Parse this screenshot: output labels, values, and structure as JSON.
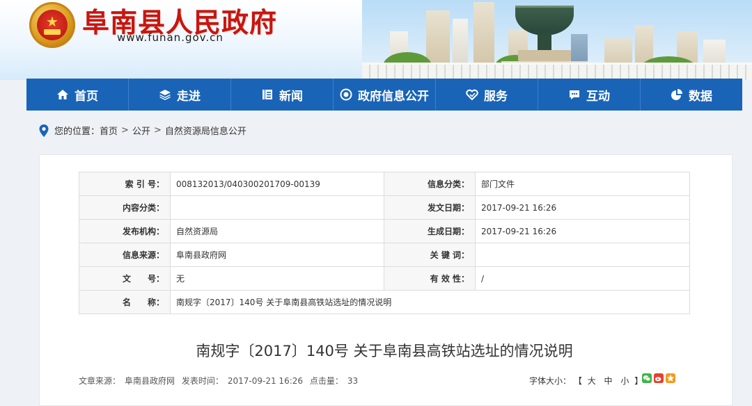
{
  "header": {
    "site_title": "阜南县人民政府",
    "site_url": "www.funan.gov.cn"
  },
  "nav": {
    "items": [
      {
        "label": "首页",
        "icon": "home-icon"
      },
      {
        "label": "走进",
        "icon": "layers-icon"
      },
      {
        "label": "新闻",
        "icon": "news-icon"
      },
      {
        "label": "政府信息公开",
        "icon": "eye-icon"
      },
      {
        "label": "服务",
        "icon": "service-icon"
      },
      {
        "label": "互动",
        "icon": "chat-icon"
      },
      {
        "label": "数据",
        "icon": "pie-chart-icon"
      }
    ]
  },
  "breadcrumb": {
    "prefix": "您的位置：",
    "items": [
      "首页",
      "公开",
      "自然资源局信息公开"
    ],
    "separator": ">"
  },
  "meta": {
    "index_label": "索 引 号：",
    "index_value": "008132013/040300201709-00139",
    "category_label": "信息分类：",
    "category_value": "部门文件",
    "content_class_label": "内容分类：",
    "content_class_value": "",
    "issue_date_label": "发文日期：",
    "issue_date_value": "2017-09-21 16:26",
    "publisher_label": "发布机构：",
    "publisher_value": "自然资源局",
    "generate_date_label": "生成日期：",
    "generate_date_value": "2017-09-21 16:26",
    "source_label": "信息来源：",
    "source_value": "阜南县政府网",
    "keywords_label": "关 键 词：",
    "keywords_value": "",
    "doc_no_label": "文　　号：",
    "doc_no_value": "无",
    "validity_label": "有 效 性：",
    "validity_value": "/",
    "name_label": "名　　称：",
    "name_value": "南规字〔2017〕140号 关于阜南县高铁站选址的情况说明"
  },
  "article": {
    "title": "南规字〔2017〕140号 关于阜南县高铁站选址的情况说明",
    "source_label": "文章来源：",
    "source_value": "阜南县政府网",
    "time_label": "发表时间：",
    "time_value": "2017-09-21 16:26",
    "clicks_label": "点击量：",
    "clicks_value": "33",
    "fontsize_label": "字体大小：",
    "bracket_open": "【",
    "size_large": "大",
    "size_medium": "中",
    "size_small": "小",
    "bracket_close": "】"
  },
  "colors": {
    "nav_bg": "#1964b7",
    "title_red": "#c8160f"
  }
}
